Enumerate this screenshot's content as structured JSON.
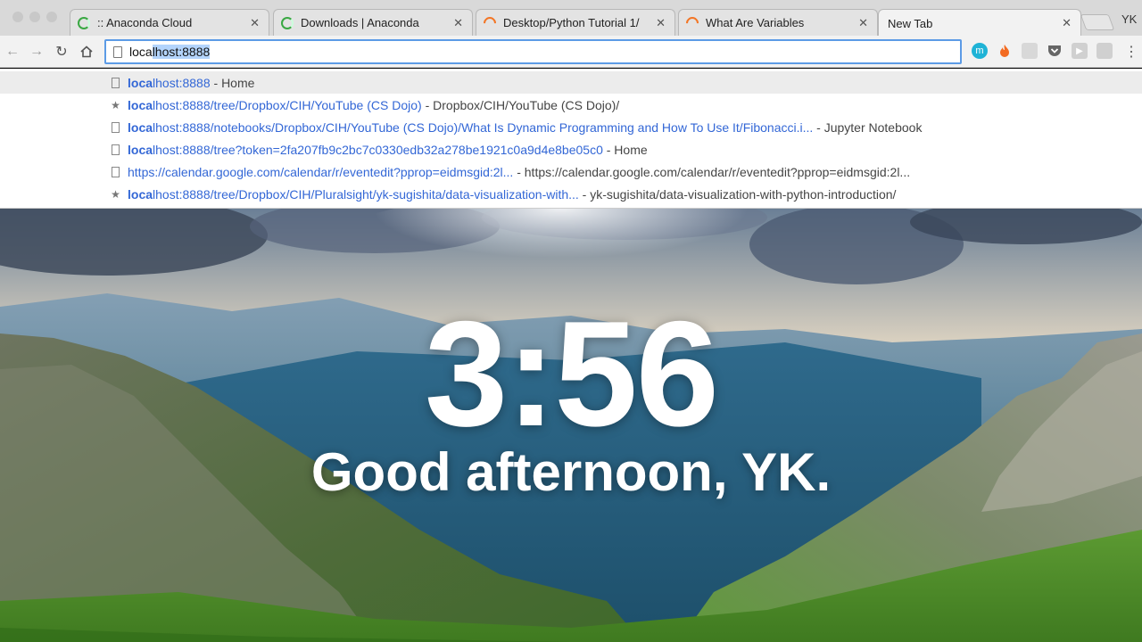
{
  "tabs": [
    {
      "title": ":: Anaconda Cloud",
      "icon": "anaconda-icon"
    },
    {
      "title": "Downloads | Anaconda",
      "icon": "anaconda-icon"
    },
    {
      "title": "Desktop/Python Tutorial 1/",
      "icon": "jupyter-icon"
    },
    {
      "title": "What Are Variables",
      "icon": "jupyter-icon"
    },
    {
      "title": "New Tab",
      "icon": "none"
    }
  ],
  "profile": "YK",
  "address_bar": {
    "typed": "loca",
    "autocomplete": "lhost:8888"
  },
  "suggestions": [
    {
      "match": "loca",
      "url_rest": "lhost:8888",
      "desc": " - Home",
      "icon": "page-icon"
    },
    {
      "match": "loca",
      "url_rest": "lhost:8888/tree/Dropbox/CIH/YouTube (CS Dojo)",
      "desc": " - Dropbox/CIH/YouTube (CS Dojo)/",
      "icon": "star-icon"
    },
    {
      "match": "loca",
      "url_rest": "lhost:8888/notebooks/Dropbox/CIH/YouTube (CS Dojo)/What Is Dynamic Programming and How To Use It/Fibonacci.i...",
      "desc": " - Jupyter Notebook",
      "icon": "page-icon"
    },
    {
      "match": "loca",
      "url_rest": "lhost:8888/tree?token=2fa207fb9c2bc7c0330edb32a278be1921c0a9d4e8be05c0",
      "desc": " - Home",
      "icon": "page-icon"
    },
    {
      "match": "",
      "url_rest": "https://calendar.google.com/calendar/r/eventedit?pprop=eidmsgid:2l...",
      "desc": " - https://calendar.google.com/calendar/r/eventedit?pprop=eidmsgid:2l...",
      "icon": "page-icon"
    },
    {
      "match": "loca",
      "url_rest": "lhost:8888/tree/Dropbox/CIH/Pluralsight/yk-sugishita/data-visualization-with...",
      "desc": " - yk-sugishita/data-visualization-with-python-introduction/",
      "icon": "star-icon"
    }
  ],
  "new_tab_page": {
    "time": "3:56",
    "greeting": "Good afternoon, YK."
  },
  "colors": {
    "link": "#3367d6",
    "focus": "#5c9be6"
  }
}
